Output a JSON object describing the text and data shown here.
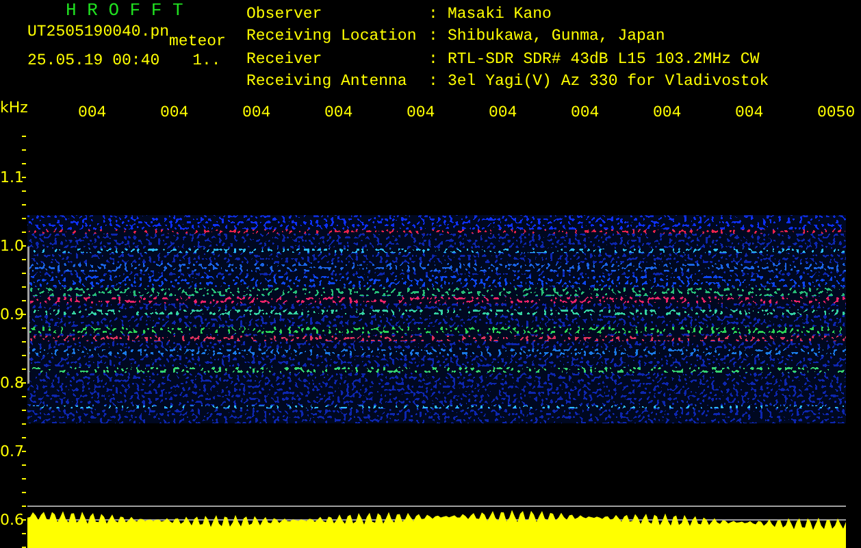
{
  "header": {
    "title": "H R O F F T",
    "file_name": "UT2505190040.pn",
    "mode": "meteor",
    "datetime": "25.05.19 00:40",
    "counter": "1..",
    "info": [
      {
        "label": "Observer",
        "value": "Masaki Kano"
      },
      {
        "label": "Receiving Location",
        "value": "Shibukawa, Gunma, Japan"
      },
      {
        "label": "Receiver",
        "value": "RTL-SDR SDR# 43dB L15 103.2MHz CW"
      },
      {
        "label": "Receiving Antenna",
        "value": "3el Yagi(V) Az 330 for Vladivostok"
      }
    ],
    "separator": ":"
  },
  "time_axis": {
    "labels": [
      "004",
      "004",
      "004",
      "004",
      "004",
      "004",
      "004",
      "004",
      "004",
      "0050"
    ]
  },
  "freq_axis": {
    "unit": "kHz",
    "labels": [
      "1.1",
      "1.0",
      "0.9",
      "0.8",
      "0.7",
      "0.6"
    ]
  }
}
